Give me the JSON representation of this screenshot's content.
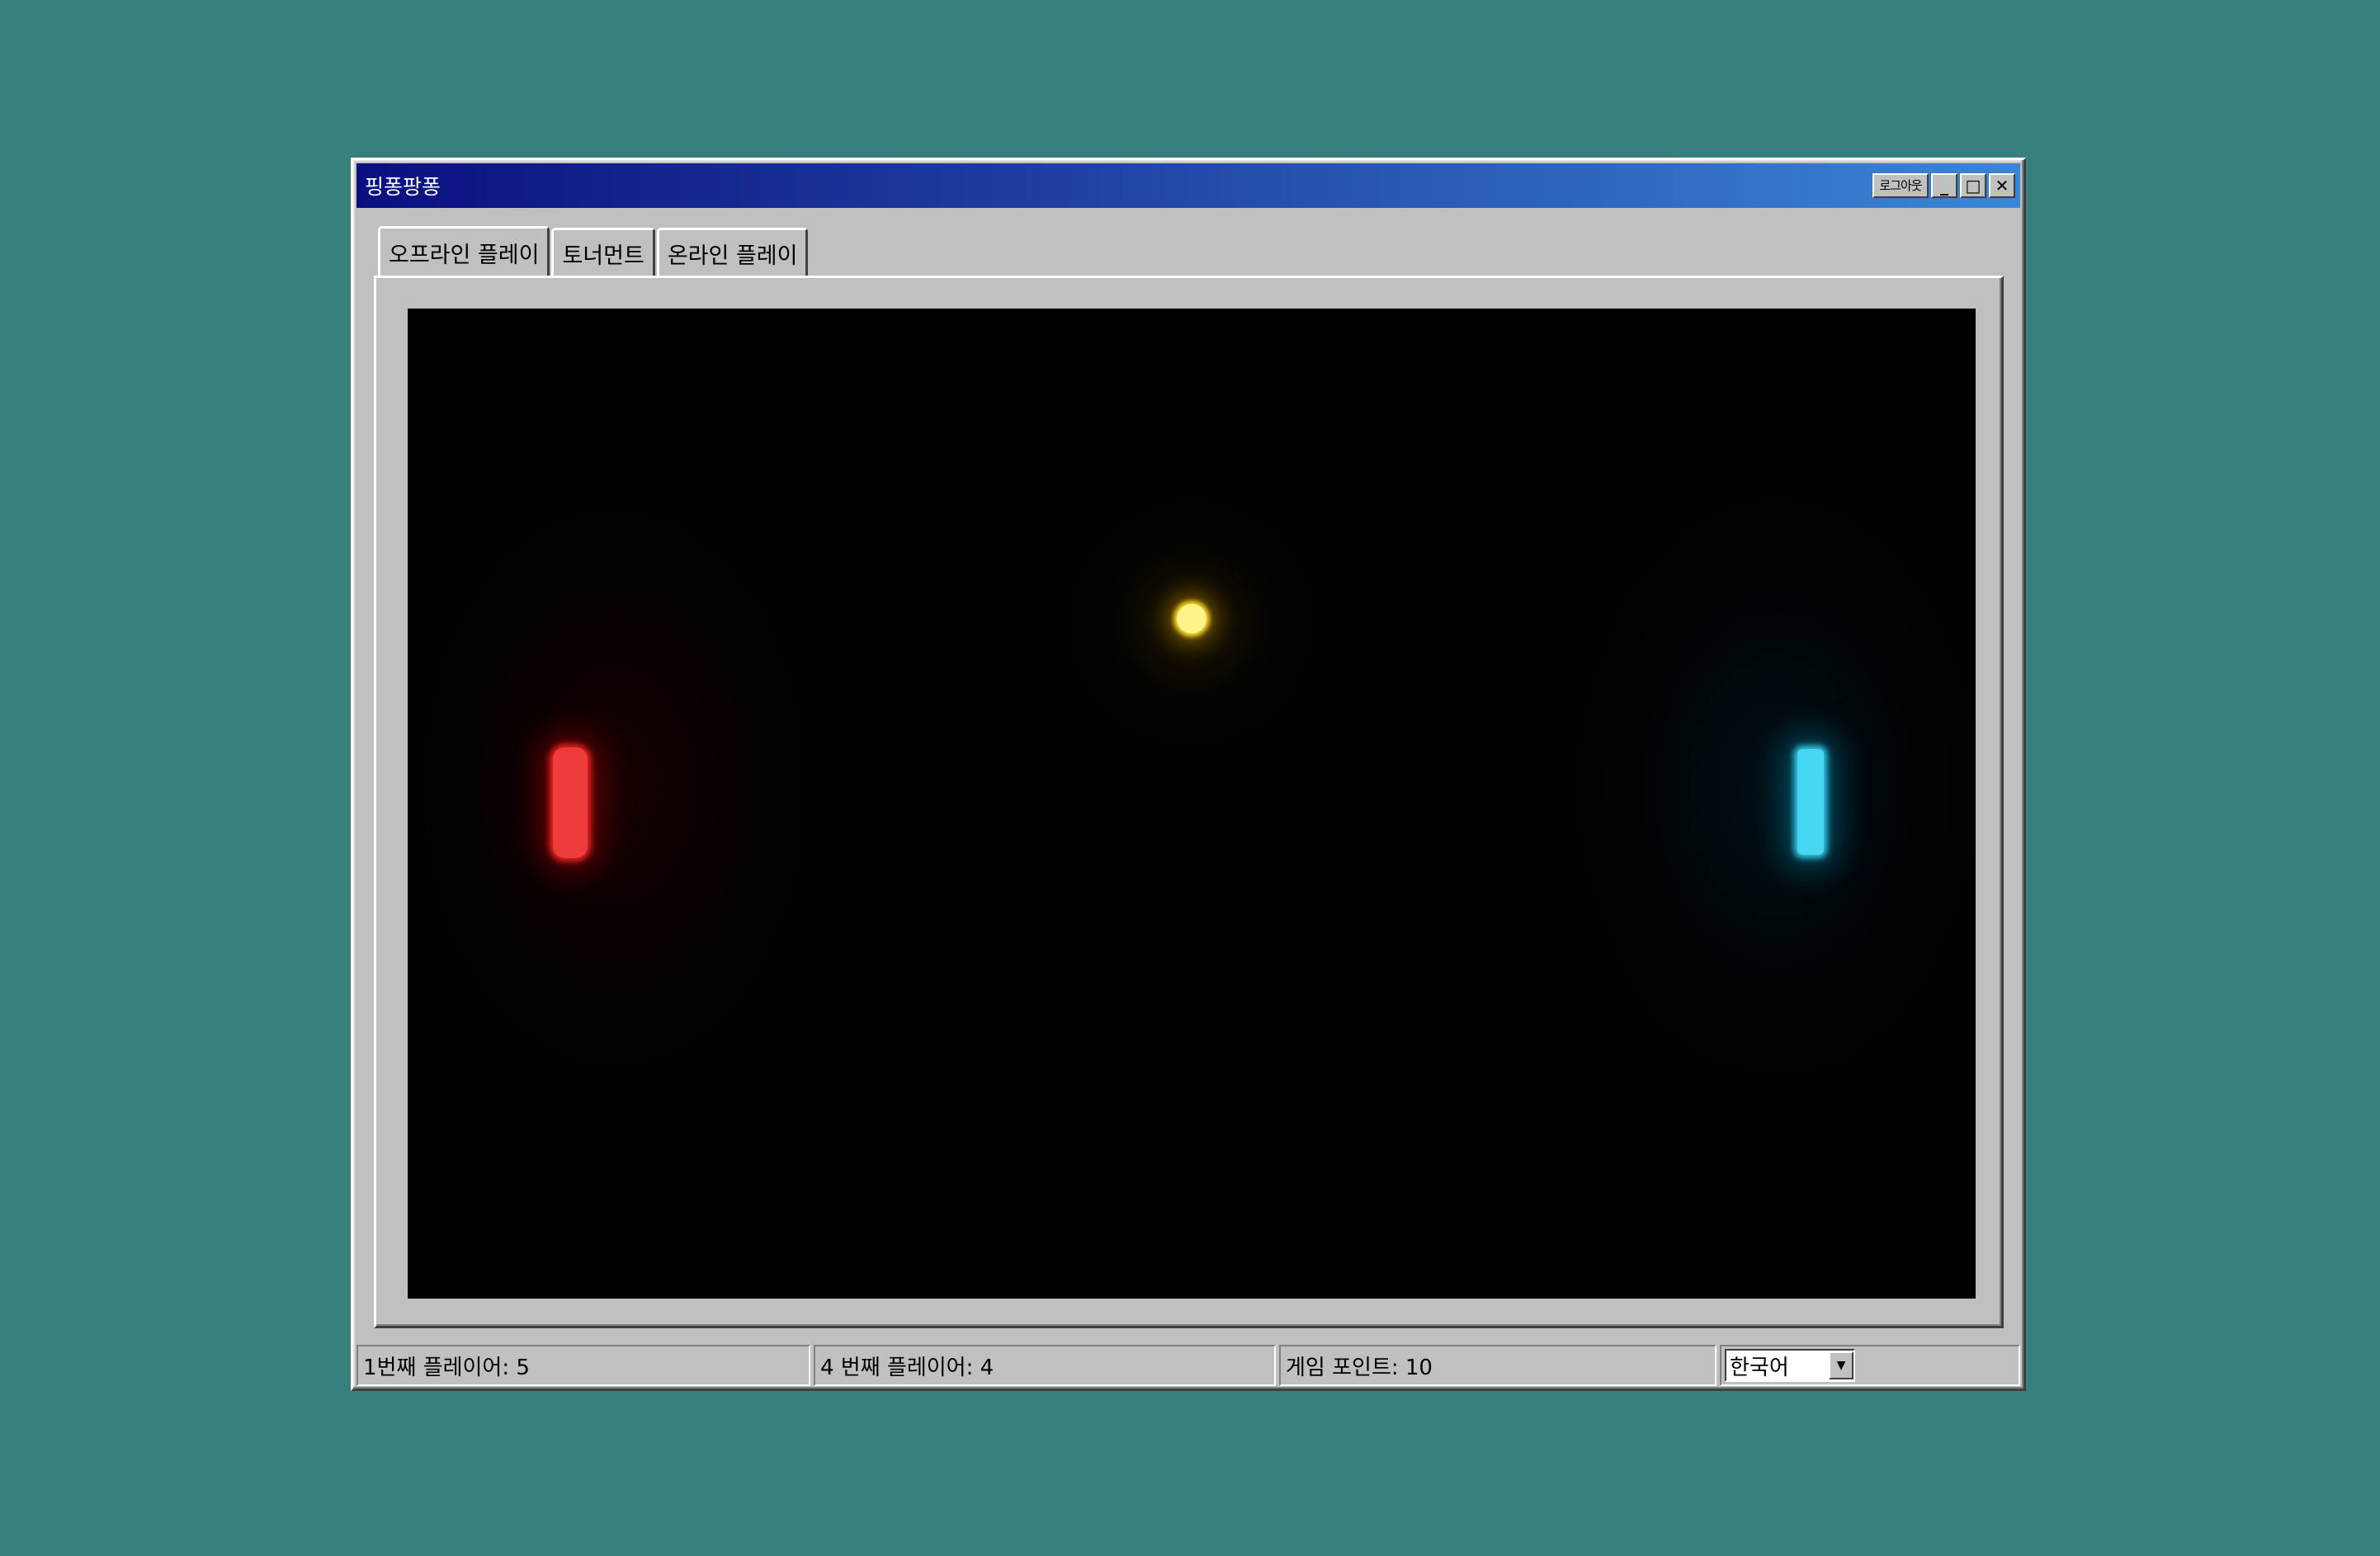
{
  "window": {
    "title": "핑퐁팡퐁",
    "buttons": {
      "logout": "로그아웃",
      "minimize_icon": "minimize-icon",
      "maximize_icon": "maximize-icon",
      "close_icon": "close-icon"
    }
  },
  "tabs": [
    {
      "label": "오프라인 플레이",
      "active": true
    },
    {
      "label": "토너먼트",
      "active": false
    },
    {
      "label": "온라인 플레이",
      "active": false
    }
  ],
  "game": {
    "background": "#000000",
    "left_paddle_color": "#ee3b3b",
    "right_paddle_color": "#47d7f2",
    "ball_color": "#fff48a"
  },
  "status": {
    "player1": "1번째 플레이어: 5",
    "player2": "4 번째 플레이어: 4",
    "game_points": "게임 포인트: 10",
    "language": "한국어"
  }
}
